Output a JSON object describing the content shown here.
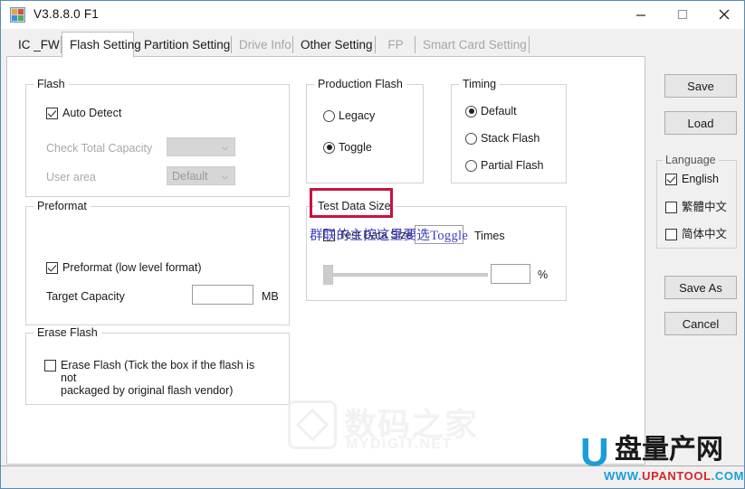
{
  "window": {
    "title": "V3.8.8.0 F1",
    "icon": "app-blocks-icon",
    "minimize_label": "Minimize",
    "maximize_label": "Maximize",
    "close_label": "Close"
  },
  "tabs": [
    {
      "label": "IC _FW",
      "active": false,
      "disabled": false
    },
    {
      "label": "Flash Setting",
      "active": true,
      "disabled": false
    },
    {
      "label": "Partition Setting",
      "active": false,
      "disabled": false
    },
    {
      "label": "Drive Info",
      "active": false,
      "disabled": true
    },
    {
      "label": "Other Setting",
      "active": false,
      "disabled": false
    },
    {
      "label": "FP",
      "active": false,
      "disabled": true
    },
    {
      "label": "Smart Card Setting",
      "active": false,
      "disabled": true
    }
  ],
  "flash_group": {
    "title": "Flash",
    "auto_detect": {
      "label": "Auto Detect",
      "checked": true
    },
    "check_total_capacity": {
      "label": "Check Total Capacity",
      "value": "",
      "disabled": true
    },
    "user_area": {
      "label": "User area",
      "value": "Default",
      "disabled": true
    }
  },
  "preformat_group": {
    "title": "Preformat",
    "preformat": {
      "label": "Preformat (low level format)",
      "checked": true
    },
    "target_capacity": {
      "label": "Target Capacity",
      "value": "",
      "unit": "MB"
    }
  },
  "erase_group": {
    "title": "Erase Flash",
    "erase": {
      "label": "Erase Flash (Tick the box if the flash is not\npackaged by original flash vendor)",
      "checked": false
    }
  },
  "production_flash_group": {
    "title": "Production Flash",
    "options": [
      {
        "label": "Legacy",
        "selected": false
      },
      {
        "label": "Toggle",
        "selected": true
      }
    ],
    "highlight_color": "#c9133f"
  },
  "timing_group": {
    "title": "Timing",
    "options": [
      {
        "label": "Default",
        "selected": true
      },
      {
        "label": "Stack Flash",
        "selected": false
      },
      {
        "label": "Partial Flash",
        "selected": false
      }
    ]
  },
  "test_data_size_group": {
    "title": "Test Data Size",
    "enable": {
      "label": "Test Data Size",
      "checked": false
    },
    "times_value": "",
    "times_label": "Times",
    "percent_value": "",
    "percent_label": "%",
    "slider_percent": 0
  },
  "annotation": {
    "text": "群联的主控这里要选Toggle",
    "color": "#3c3cc8"
  },
  "sidebar": {
    "save_label": "Save",
    "load_label": "Load",
    "save_as_label": "Save As",
    "cancel_label": "Cancel",
    "language": {
      "title": "Language",
      "items": [
        {
          "label": "English",
          "checked": true
        },
        {
          "label": "繁體中文",
          "checked": false
        },
        {
          "label": "简体中文",
          "checked": false
        }
      ]
    }
  },
  "watermark": {
    "cn": "数码之家",
    "en": "MYDIGIT.NET",
    "icon": "house-watermark-icon"
  },
  "logo": {
    "mark": "U",
    "cn": "盘量产网",
    "url_prefix": "WWW.",
    "url_name": "UPANTOOL",
    "url_suffix": ".COM",
    "brand_blue": "#1a9ed9",
    "brand_red": "#d92626"
  }
}
